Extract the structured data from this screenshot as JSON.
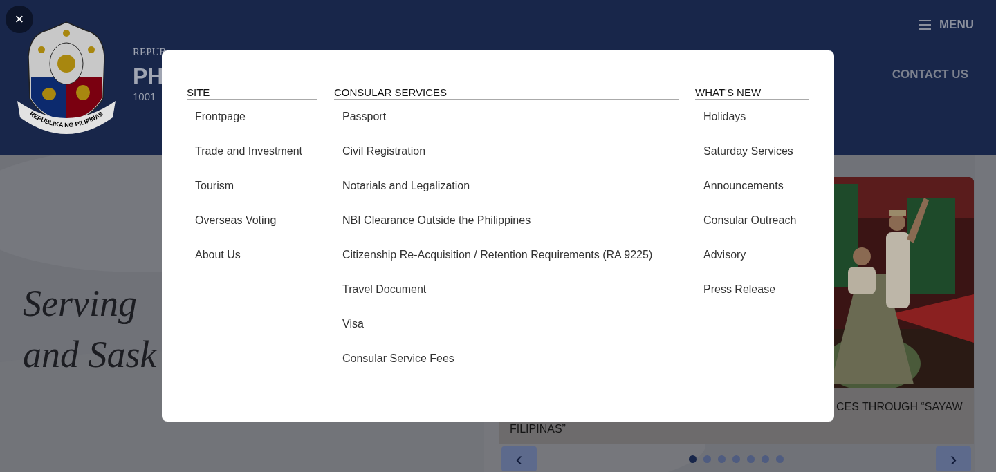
{
  "close_button": "×",
  "header": {
    "overline": "REPUB",
    "title": "PH",
    "address": "1001",
    "logo_motto": "REPUBLIKA NG PILIPINAS",
    "menu_label": "MENU",
    "contact_label": "CONTACT US"
  },
  "hero": {
    "lines": [
      "Serving",
      "and Sask"
    ]
  },
  "carousel": {
    "caption_lines": [
      "CES THROUGH “SAYAW",
      "FILIPINAS”"
    ],
    "prev": "‹",
    "next": "›",
    "dots": [
      {
        "selected": true
      },
      {
        "selected": false
      },
      {
        "selected": false
      },
      {
        "selected": false
      },
      {
        "selected": false
      },
      {
        "selected": false
      },
      {
        "selected": false
      }
    ]
  },
  "menu": {
    "columns": [
      {
        "heading": "SITE",
        "items": [
          "Frontpage",
          "Trade and Investment",
          "Tourism",
          "Overseas Voting",
          "About Us"
        ]
      },
      {
        "heading": "CONSULAR SERVICES",
        "items": [
          "Passport",
          "Civil Registration",
          "Notarials and Legalization",
          "NBI Clearance Outside the Philippines",
          "Citizenship Re-Acquisition / Retention Requirements (RA 9225)",
          "Travel Document",
          "Visa",
          "Consular Service Fees"
        ]
      },
      {
        "heading": "WHAT'S NEW",
        "items": [
          "Holidays",
          "Saturday Services",
          "Announcements",
          "Consular Outreach",
          "Advisory",
          "Press Release"
        ]
      }
    ]
  }
}
